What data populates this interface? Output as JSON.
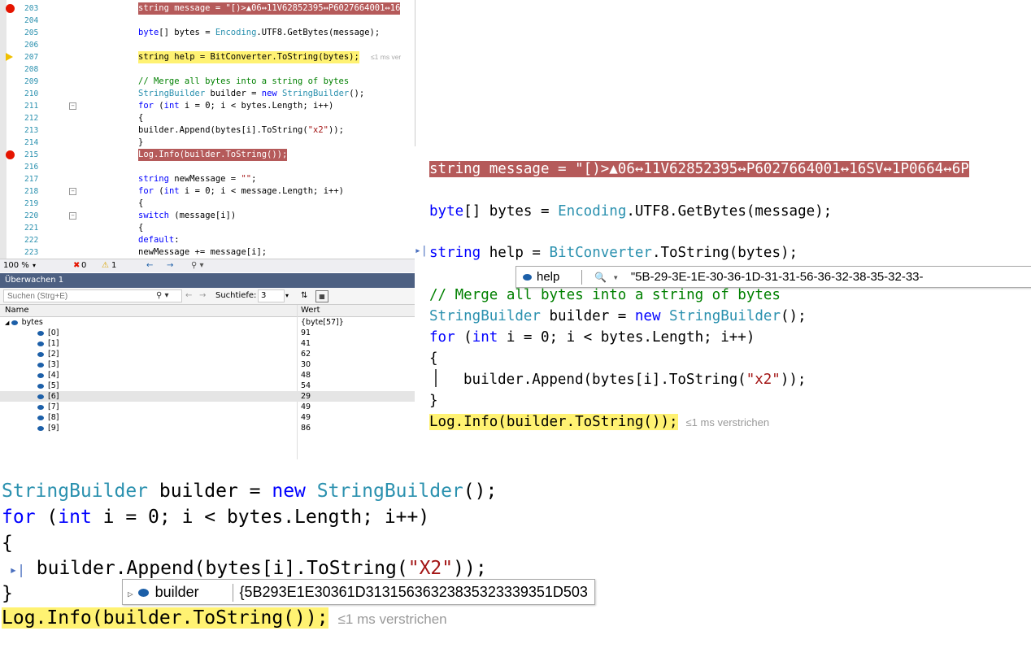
{
  "editor_top": {
    "lines": [
      {
        "n": "203",
        "bp": true,
        "code": "string message = \"[)>▲06↔11V62852395↔P6027664001↔16"
      },
      {
        "n": "204",
        "code": ""
      },
      {
        "n": "205",
        "code": "byte[] bytes = Encoding.UTF8.GetBytes(message);"
      },
      {
        "n": "206",
        "code": ""
      },
      {
        "n": "207",
        "current": true,
        "code": "string help = BitConverter.ToString(bytes);",
        "elapsed": "≤1 ms ver"
      },
      {
        "n": "208",
        "code": ""
      },
      {
        "n": "209",
        "code": "// Merge all bytes into a string of bytes"
      },
      {
        "n": "210",
        "code": "StringBuilder builder = new StringBuilder();"
      },
      {
        "n": "211",
        "fold": true,
        "code": "for (int i = 0; i < bytes.Length; i++)"
      },
      {
        "n": "212",
        "code": "{"
      },
      {
        "n": "213",
        "code": "    builder.Append(bytes[i].ToString(\"x2\"));"
      },
      {
        "n": "214",
        "code": "}"
      },
      {
        "n": "215",
        "bp": true,
        "code": "Log.Info(builder.ToString());"
      },
      {
        "n": "216",
        "code": ""
      },
      {
        "n": "217",
        "code": "string newMessage = \"\";"
      },
      {
        "n": "218",
        "fold": true,
        "code": "for (int i = 0; i < message.Length; i++)"
      },
      {
        "n": "219",
        "code": "{"
      },
      {
        "n": "220",
        "fold": true,
        "code": "    switch (message[i])"
      },
      {
        "n": "221",
        "code": "    {"
      },
      {
        "n": "222",
        "code": "        default:"
      },
      {
        "n": "223",
        "code": "            newMessage += message[i];"
      }
    ],
    "status": {
      "zoom": "100 %",
      "errors": "0",
      "warnings": "1"
    }
  },
  "watch": {
    "title": "Überwachen 1",
    "search_placeholder": "Suchen (Strg+E)",
    "depth_label": "Suchtiefe:",
    "depth_value": "3",
    "col_name": "Name",
    "col_value": "Wert",
    "rows": [
      {
        "name": "bytes",
        "value": "{byte[57]}",
        "root": true
      },
      {
        "name": "[0]",
        "value": "91"
      },
      {
        "name": "[1]",
        "value": "41"
      },
      {
        "name": "[2]",
        "value": "62"
      },
      {
        "name": "[3]",
        "value": "30"
      },
      {
        "name": "[4]",
        "value": "48"
      },
      {
        "name": "[5]",
        "value": "54"
      },
      {
        "name": "[6]",
        "value": "29",
        "selected": true
      },
      {
        "name": "[7]",
        "value": "49"
      },
      {
        "name": "[8]",
        "value": "49"
      },
      {
        "name": "[9]",
        "value": "86"
      }
    ]
  },
  "editor_right": {
    "l1_a": "string message = ",
    "l1_b": "\"[)>▲06↔11V62852395↔P6027664001↔16SV↔1P0664↔6P",
    "l2_a": "byte",
    "l2_b": "[] bytes = ",
    "l2_c": "Encoding",
    "l2_d": ".UTF8.GetBytes(message);",
    "l3_a": "string",
    "l3_b": " help = ",
    "l3_c": "BitConverter",
    "l3_d": ".ToString(bytes);",
    "tip_name": "help",
    "tip_search": "🔍 ▾",
    "tip_value": "\"5B-29-3E-1E-30-36-1D-31-31-56-36-32-38-35-32-33-",
    "l4": "// Merge all bytes into a string of bytes",
    "l5_a": "StringBuilder",
    "l5_b": " builder = ",
    "l5_c": "new",
    "l5_d": " ",
    "l5_e": "StringBuilder",
    "l5_f": "();",
    "l6_a": "for",
    "l6_b": " (",
    "l6_c": "int",
    "l6_d": " i = 0; i < bytes.Length; i++)",
    "l7": "{",
    "l8_a": "builder.Append(bytes[i].ToString(",
    "l8_b": "\"x2\"",
    "l8_c": "));",
    "l9": "}",
    "l10": "Log.Info(builder.ToString());",
    "elapsed": "≤1 ms verstrichen"
  },
  "editor_bottom": {
    "l1_a": "StringBuilder",
    "l1_b": " builder = ",
    "l1_c": "new",
    "l1_d": "StringBuilder",
    "l1_e": "();",
    "l2_a": "for",
    "l2_b": " (",
    "l2_c": "int",
    "l2_d": " i = 0; i < bytes.Length; i++)",
    "l3": "{",
    "l4_a": "builder.Append(bytes[i].ToString(",
    "l4_b": "\"X2\"",
    "l4_c": "));",
    "l5": "}",
    "tip_name": "builder",
    "tip_value": "{5B293E1E30361D31315636323835323339351D503",
    "l6": "Log.Info(builder.ToString());",
    "elapsed": "≤1 ms verstrichen"
  }
}
